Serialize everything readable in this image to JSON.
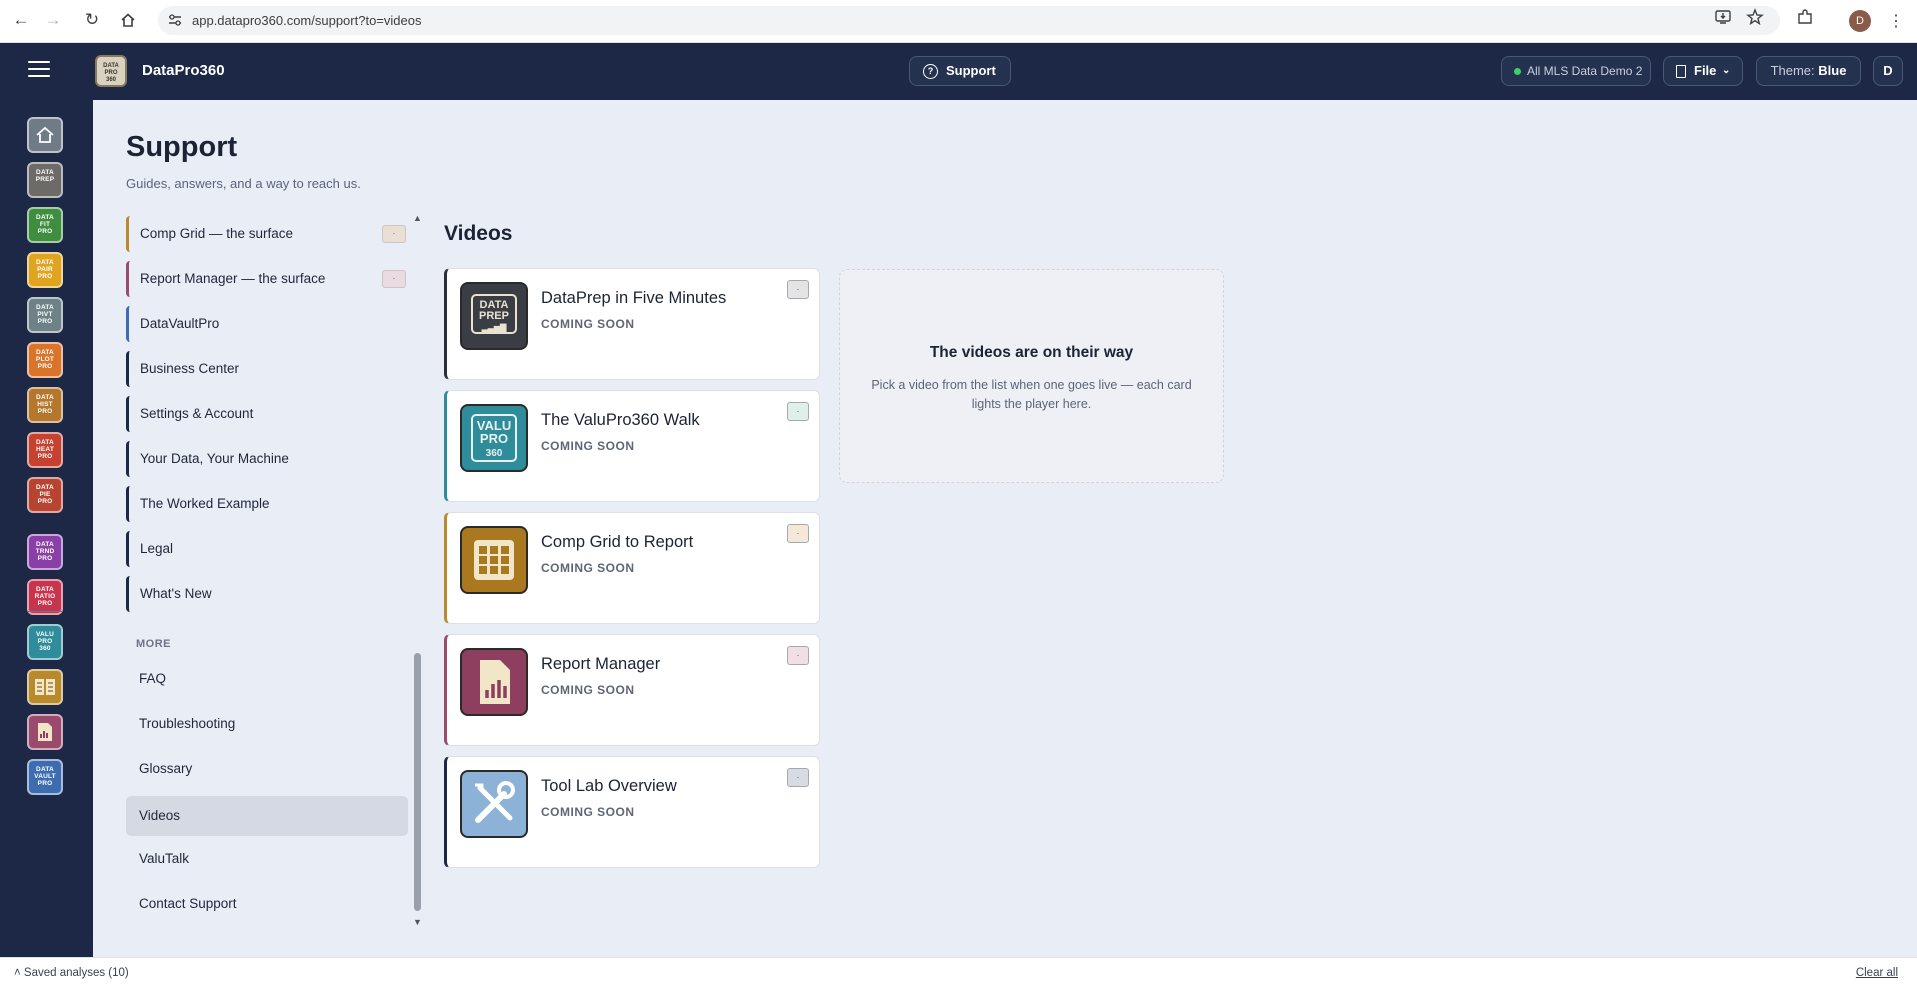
{
  "browser": {
    "url": "app.datapro360.com/support?to=videos",
    "profile_initial": "D"
  },
  "header": {
    "brand_logo_text": "DATA PRO 360",
    "brand_name": "DataPro360",
    "support_label": "Support",
    "dataset_label": "All MLS Data Demo 2",
    "file_label": "File",
    "theme_prefix": "Theme:",
    "theme_value": "Blue",
    "user_initial": "D"
  },
  "rail": {
    "items": [
      {
        "name": "home-icon",
        "text": "",
        "bg": "#6f7b86"
      },
      {
        "name": "dataprep",
        "text": "DATA PREP",
        "bg": "#6d6b68"
      },
      {
        "name": "datafit",
        "text": "DATA FIT PRO",
        "bg": "#3f8e3f"
      },
      {
        "name": "datapair",
        "text": "DATA PAIR PRO",
        "bg": "#e0a520"
      },
      {
        "name": "datapivt",
        "text": "DATA PIVT PRO",
        "bg": "#6d8187"
      },
      {
        "name": "dataplot",
        "text": "DATA PLOT PRO",
        "bg": "#d9742b"
      },
      {
        "name": "datahist",
        "text": "DATA HIST PRO",
        "bg": "#b4772c"
      },
      {
        "name": "dataheat",
        "text": "DATA HEAT PRO",
        "bg": "#c4422f"
      },
      {
        "name": "datapie",
        "text": "DATA PIE PRO",
        "bg": "#b74431"
      },
      {
        "name": "datatrnd",
        "text": "DATA TRND PRO",
        "bg": "#8a3fa8"
      },
      {
        "name": "dataratio",
        "text": "DATA RATIO PRO",
        "bg": "#c7344d"
      },
      {
        "name": "valupro",
        "text": "VALU PRO 360",
        "bg": "#2f8d9b"
      },
      {
        "name": "compgrid",
        "text": "",
        "bg": "#b98a2c"
      },
      {
        "name": "reportmgr",
        "text": "",
        "bg": "#9a4a6d"
      },
      {
        "name": "datavault",
        "text": "DATA VAULT PRO",
        "bg": "#3d6db0"
      }
    ]
  },
  "page": {
    "title": "Support",
    "subtitle": "Guides, answers, and a way to reach us."
  },
  "toc": {
    "items": [
      {
        "label": "Comp Grid — the surface",
        "badge": "·",
        "color": "#b98a2c"
      },
      {
        "label": "Report Manager — the surface",
        "badge": "·",
        "color": "#9a4a6d"
      },
      {
        "label": "DataVaultPro",
        "color": "#3d6db0"
      },
      {
        "label": "Business Center",
        "color": "#1c2845"
      },
      {
        "label": "Settings & Account",
        "color": "#1c2845"
      },
      {
        "label": "Your Data, Your Machine",
        "color": "#1c2845"
      },
      {
        "label": "The Worked Example",
        "color": "#1c2845"
      },
      {
        "label": "Legal",
        "color": "#1c2845"
      },
      {
        "label": "What's New",
        "color": "#1c2845"
      }
    ],
    "more_heading": "MORE",
    "more_items": [
      "FAQ",
      "Troubleshooting",
      "Glossary",
      "Videos",
      "ValuTalk",
      "Contact Support"
    ],
    "active_item": "Videos"
  },
  "videos": {
    "heading": "Videos",
    "cards": [
      {
        "title": "DataPrep in Five Minutes",
        "status": "COMING SOON",
        "badge": "·",
        "accent": "#2b2f3a",
        "thumb_text": "DATA PREP",
        "thumb_bg": "#3a3d44"
      },
      {
        "title": "The ValuPro360 Walk",
        "status": "COMING SOON",
        "badge": "·",
        "accent": "#2f8d9b",
        "thumb_text": "VALU PRO 360",
        "thumb_bg": "#2f8d9b"
      },
      {
        "title": "Comp Grid to Report",
        "status": "COMING SOON",
        "badge": "·",
        "accent": "#b98a2c",
        "thumb_text": "",
        "thumb_bg": "#a9781f"
      },
      {
        "title": "Report Manager",
        "status": "COMING SOON",
        "badge": "·",
        "accent": "#9a4a6d",
        "thumb_text": "",
        "thumb_bg": "#8e3f5f"
      },
      {
        "title": "Tool Lab Overview",
        "status": "COMING SOON",
        "badge": "·",
        "accent": "#1c2845",
        "thumb_text": "",
        "thumb_bg": "#8cb2d8"
      }
    ],
    "player_title": "The videos are on their way",
    "player_desc": "Pick a video from the list when one goes live — each card lights the player here."
  },
  "footer": {
    "saved_label": "Saved analyses (10)",
    "clear_label": "Clear all"
  }
}
